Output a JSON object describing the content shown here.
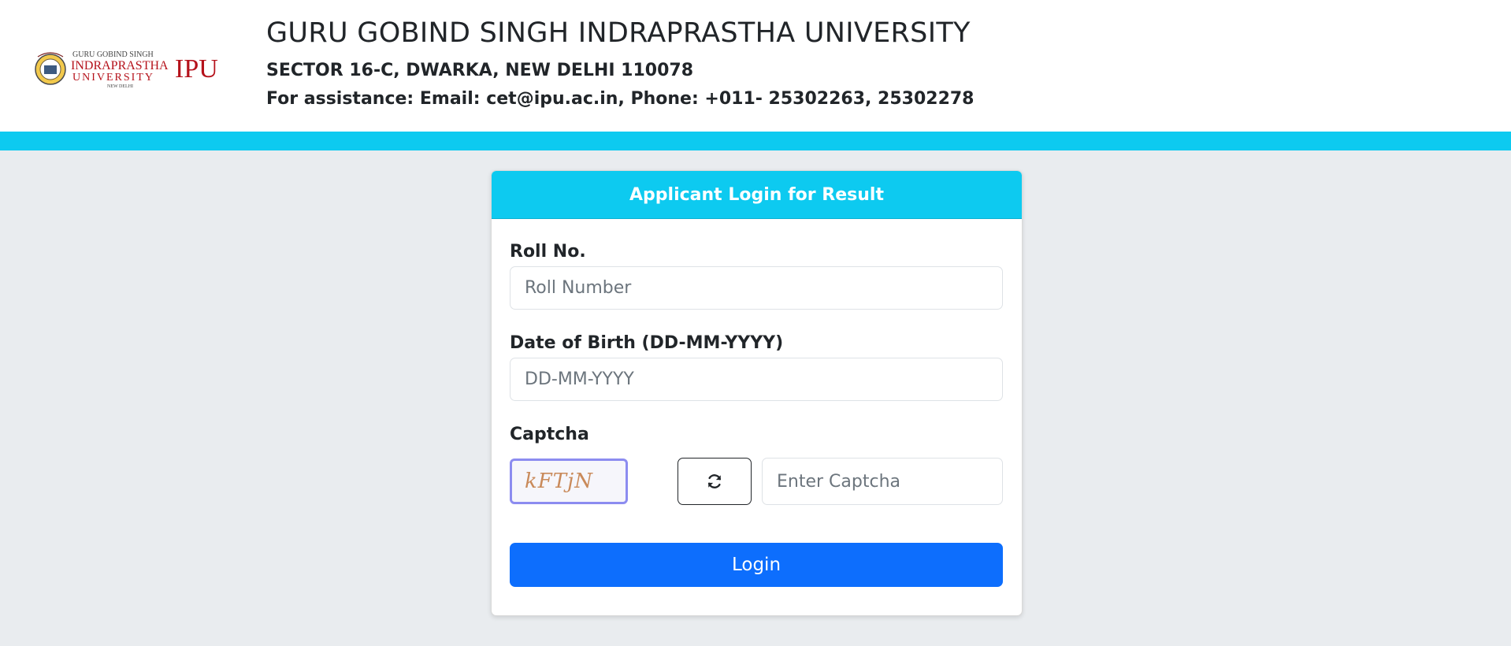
{
  "header": {
    "logo": {
      "text_top": "GURU GOBIND SINGH",
      "text_mid": "INDRAPRASTHA",
      "text_bottom": "UNIVERSITY",
      "text_city": "NEW DELHI",
      "monogram": "IPU"
    },
    "title": "GURU GOBIND SINGH INDRAPRASTHA UNIVERSITY",
    "address": "SECTOR 16-C, DWARKA, NEW DELHI 110078",
    "contact": "For assistance: Email: cet@ipu.ac.in, Phone: +011- 25302263, 25302278"
  },
  "colors": {
    "accent_band": "#0dcaf0",
    "primary_button": "#0d6efd",
    "page_background": "#e9ecef"
  },
  "login_card": {
    "title": "Applicant Login for Result",
    "roll_no": {
      "label": "Roll No.",
      "placeholder": "Roll Number",
      "value": ""
    },
    "dob": {
      "label": "Date of Birth (DD-MM-YYYY)",
      "placeholder": "DD-MM-YYYY",
      "value": ""
    },
    "captcha": {
      "label": "Captcha",
      "image_text": "kFTjN",
      "refresh_icon": "refresh-icon",
      "placeholder": "Enter Captcha",
      "value": ""
    },
    "login_label": "Login"
  }
}
